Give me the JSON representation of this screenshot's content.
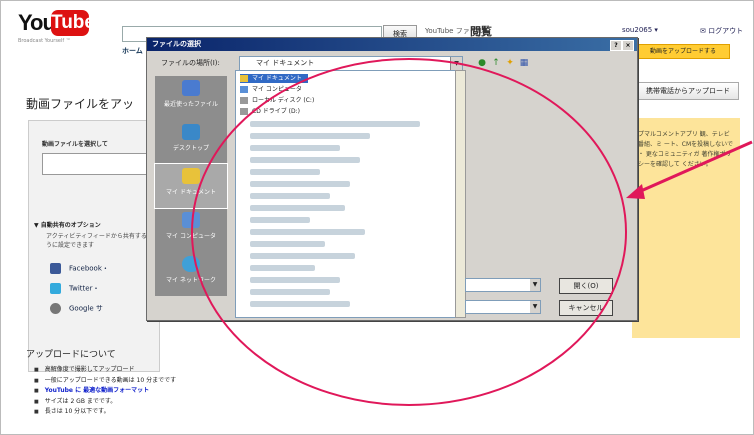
{
  "header": {
    "logo_you": "You",
    "logo_tube": "Tube",
    "logo_tagline": "Broadcast Yourself ™",
    "search_button": "検索",
    "link_primary": "YouTube ファイル",
    "link_secondary": "閲覧",
    "user": "sou2065 ▾",
    "logout": "✉ ログアウト",
    "nav_home": "ホーム"
  },
  "page": {
    "title": "動画ファイルをアッ",
    "top_banner": "動画をアップロードする",
    "right_button": "携帯電話からアップロード",
    "select_title": "動画ファイルを選択して",
    "auto_share_title": "▼ 自動共有のオプション",
    "auto_share_desc": "アクティビティフィードから共有するように設定できます",
    "social": [
      {
        "label": "Facebook・",
        "color": "#3b5998"
      },
      {
        "label": "Twitter・",
        "color": "#33aadd"
      },
      {
        "label": "Google サ",
        "color": "#777777"
      }
    ],
    "side_note": "プマルコメントアプリ 観、テレビ番組、ミ ート、CMを投稿しないで ・ 更なコミュニティガ 著作権ポリシーを確認して ください。",
    "upload_heading": "アップロードについて",
    "bullets": [
      {
        "text": "高解像度で撮影してアップロード",
        "link": false
      },
      {
        "text": "一般にアップロードできる動画は 10 分までです",
        "link": false
      },
      {
        "text": "YouTube に 最適な動画フォーマット",
        "link": true
      },
      {
        "text": "サイズは 2 GB までです。",
        "link": false
      },
      {
        "text": "長さは 10 分以下です。",
        "link": false
      }
    ]
  },
  "dialog": {
    "title": "ファイルの選択",
    "help": "?",
    "close": "×",
    "look_in_label": "ファイルの場所(I):",
    "look_in_value": "マイ ドキュメント",
    "places": [
      {
        "label": "最近使ったファイル",
        "color": "#4a7bd0"
      },
      {
        "label": "デスクトップ",
        "color": "#3a88c8"
      },
      {
        "label": "マイ ドキュメント",
        "color": "#e8c23a"
      },
      {
        "label": "マイ コンピュータ",
        "color": "#5a8fd6"
      },
      {
        "label": "マイ ネットワーク",
        "color": "#3fa0d8"
      }
    ],
    "files": [
      {
        "label": "マイ ドキュメント",
        "selected": true,
        "color": "#e8c23a"
      },
      {
        "label": "マイ コンピュータ",
        "selected": false,
        "color": "#5a8fd6"
      },
      {
        "label": "ローカル ディスク (C:)",
        "selected": false,
        "color": "#999999"
      },
      {
        "label": "CD ドライブ (D:)",
        "selected": false,
        "color": "#999999"
      }
    ],
    "open_button": "開く(O)",
    "cancel_button": "キャンセル"
  }
}
